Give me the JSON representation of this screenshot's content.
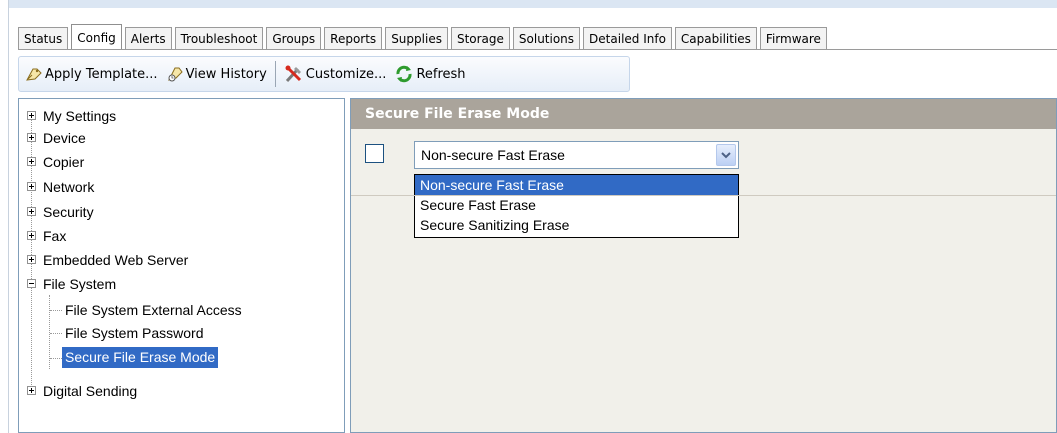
{
  "tabs": [
    {
      "label": "Status",
      "active": false
    },
    {
      "label": "Config",
      "active": true
    },
    {
      "label": "Alerts",
      "active": false
    },
    {
      "label": "Troubleshoot",
      "active": false
    },
    {
      "label": "Groups",
      "active": false
    },
    {
      "label": "Reports",
      "active": false
    },
    {
      "label": "Supplies",
      "active": false
    },
    {
      "label": "Storage",
      "active": false
    },
    {
      "label": "Solutions",
      "active": false
    },
    {
      "label": "Detailed Info",
      "active": false
    },
    {
      "label": "Capabilities",
      "active": false
    },
    {
      "label": "Firmware",
      "active": false
    }
  ],
  "toolbar": {
    "apply_template": "Apply Template...",
    "view_history": "View History",
    "customize": "Customize...",
    "refresh": "Refresh"
  },
  "tree": {
    "items": [
      {
        "label": "My Settings"
      },
      {
        "label": "Device"
      },
      {
        "label": "Copier"
      },
      {
        "label": "Network"
      },
      {
        "label": "Security"
      },
      {
        "label": "Fax"
      },
      {
        "label": "Embedded Web Server"
      },
      {
        "label": "File System"
      },
      {
        "label": "File System External Access"
      },
      {
        "label": "File System Password"
      },
      {
        "label": "Secure File Erase Mode"
      },
      {
        "label": "Digital Sending"
      }
    ]
  },
  "content": {
    "title": "Secure File Erase Mode",
    "checkbox_checked": false,
    "combo_value": "Non-secure Fast Erase",
    "options": [
      "Non-secure Fast Erase",
      "Secure Fast Erase",
      "Secure Sanitizing Erase"
    ],
    "highlighted_option": "Non-secure Fast Erase"
  },
  "colors": {
    "selection": "#316ac5",
    "header": "#aaa49b",
    "pane_bg": "#f1f0ea"
  }
}
